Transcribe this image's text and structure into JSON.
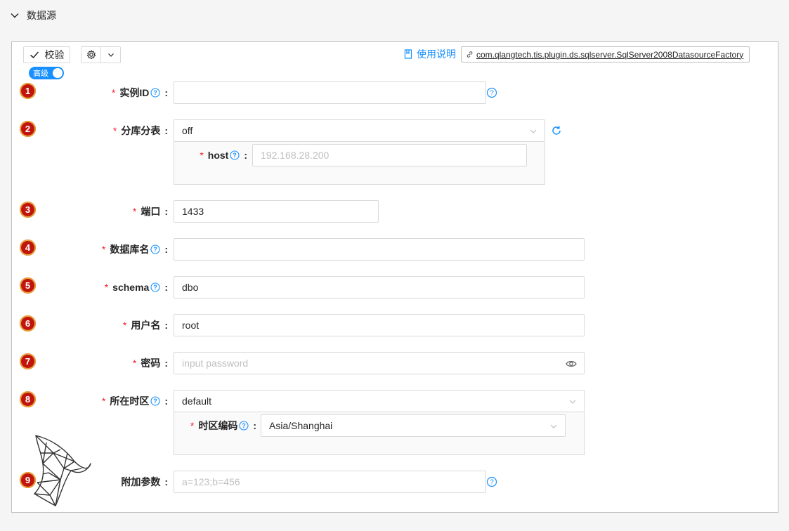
{
  "section": {
    "title": "数据源"
  },
  "toolbar": {
    "validate_label": "校验",
    "advanced_label": "高级",
    "doc_link_label": "使用说明",
    "plugin_class": "com.qlangtech.tis.plugin.ds.sqlserver.SqlServer2008DatasourceFactory"
  },
  "fields": [
    {
      "index": "1",
      "label": "实例ID",
      "required": true,
      "help": true,
      "value": "",
      "placeholder": ""
    },
    {
      "index": "2",
      "label": "分库分表",
      "required": true,
      "help": false,
      "value": "off",
      "sub": {
        "label": "host",
        "required": true,
        "value": "",
        "placeholder": "192.168.28.200"
      }
    },
    {
      "index": "3",
      "label": "端口",
      "required": true,
      "help": false,
      "value": "1433",
      "placeholder": ""
    },
    {
      "index": "4",
      "label": "数据库名",
      "required": true,
      "help": true,
      "value": "",
      "placeholder": ""
    },
    {
      "index": "5",
      "label": "schema",
      "required": true,
      "help": true,
      "value": "dbo",
      "placeholder": ""
    },
    {
      "index": "6",
      "label": "用户名",
      "required": true,
      "help": false,
      "value": "root",
      "placeholder": ""
    },
    {
      "index": "7",
      "label": "密码",
      "required": true,
      "help": false,
      "value": "",
      "placeholder": "input password"
    },
    {
      "index": "8",
      "label": "所在时区",
      "required": true,
      "help": true,
      "value": "default",
      "sub": {
        "label": "时区编码",
        "required": true,
        "value": "Asia/Shanghai"
      }
    },
    {
      "index": "9",
      "label": "附加参数",
      "required": false,
      "help": false,
      "value": "",
      "placeholder": "a=123;b=456"
    }
  ],
  "colors": {
    "accent": "#1890ff",
    "required": "#f5222d",
    "badge": "#c0140c"
  }
}
